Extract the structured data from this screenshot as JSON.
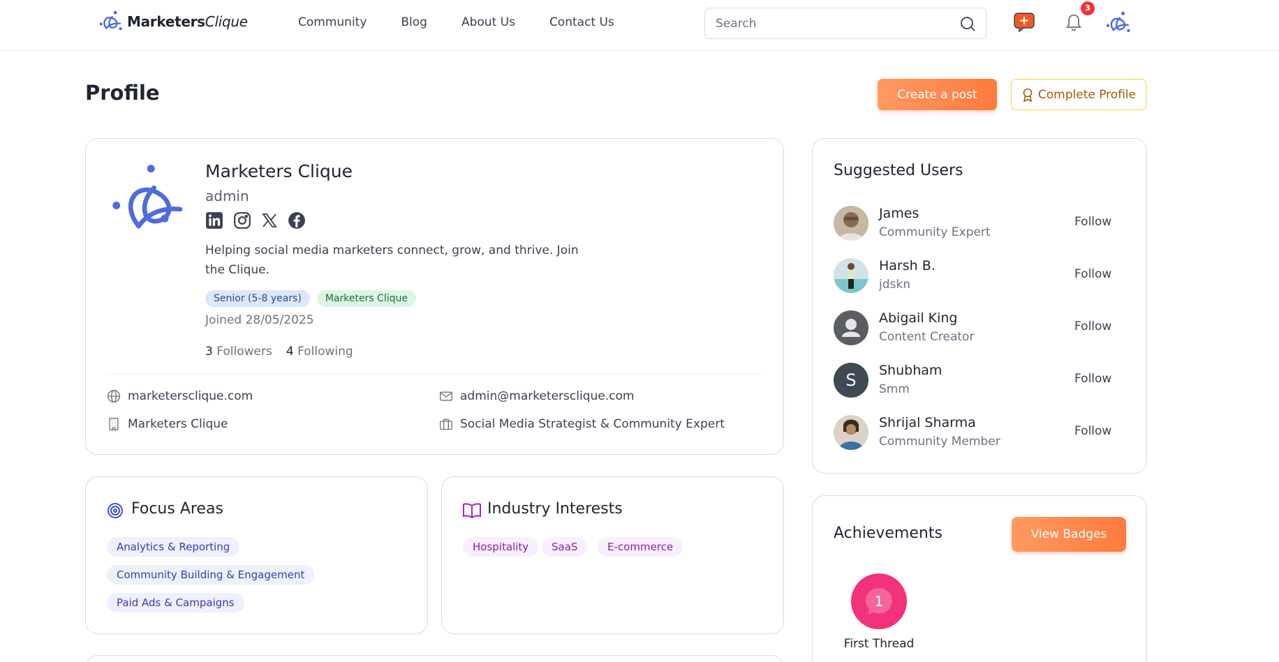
{
  "header": {
    "logo_bold": "Marketers",
    "logo_light": "Clique",
    "nav": [
      "Community",
      "Blog",
      "About Us",
      "Contact Us"
    ],
    "search_placeholder": "Search",
    "notification_count": "3"
  },
  "page": {
    "title": "Profile",
    "create_post_label": "Create a post",
    "complete_profile_label": "Complete Profile"
  },
  "profile": {
    "name": "Marketers Clique",
    "role": "admin",
    "bio": "Helping social media marketers connect, grow, and thrive. Join the Clique.",
    "tags": [
      "Senior (5-8 years)",
      "Marketers Clique"
    ],
    "joined": "Joined 28/05/2025",
    "followers_count": "3",
    "followers_label": "Followers",
    "following_count": "4",
    "following_label": "Following",
    "website": "marketersclique.com",
    "email": "admin@marketersclique.com",
    "company": "Marketers Clique",
    "position": "Social Media Strategist & Community Expert"
  },
  "suggested": {
    "title": "Suggested Users",
    "follow_label": "Follow",
    "users": [
      {
        "name": "James",
        "sub": "Community Expert"
      },
      {
        "name": "Harsh B.",
        "sub": "jdskn"
      },
      {
        "name": "Abigail King",
        "sub": "Content Creator"
      },
      {
        "name": "Shubham",
        "sub": "Smm",
        "initial": "S"
      },
      {
        "name": "Shrijal Sharma",
        "sub": "Community Member"
      }
    ]
  },
  "focus": {
    "title": "Focus Areas",
    "items": [
      "Analytics & Reporting",
      "Community Building & Engagement",
      "Paid Ads & Campaigns"
    ]
  },
  "industry": {
    "title": "Industry Interests",
    "items": [
      "Hospitality",
      "SaaS",
      "E-commerce"
    ]
  },
  "achievements": {
    "title": "Achievements",
    "view_badges_label": "View Badges",
    "badge_number": "1",
    "badge_label": "First Thread"
  },
  "colors": {
    "accent_orange": "#ff7a3d",
    "brand_blue": "#4f6bde",
    "badge_pink": "#f2327a"
  }
}
